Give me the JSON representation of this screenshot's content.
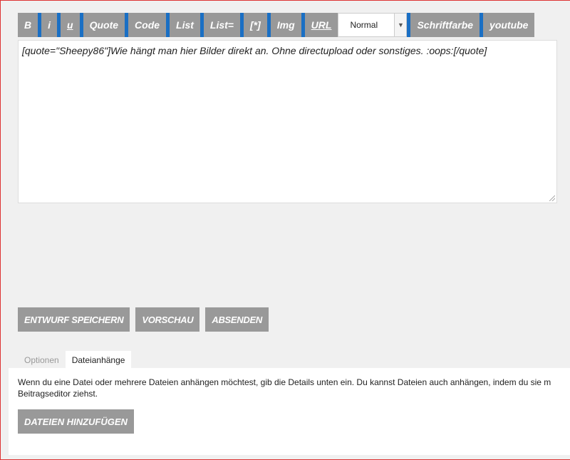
{
  "toolbar": {
    "bold": "B",
    "italic": "i",
    "underline": "u",
    "quote": "Quote",
    "code": "Code",
    "list": "List",
    "list_ordered": "List=",
    "list_item": "[*]",
    "img": "Img",
    "url": "URL",
    "font_size_selected": "Normal",
    "font_color": "Schriftfarbe",
    "youtube": "youtube"
  },
  "editor": {
    "content": "[quote=\"Sheepy86\"]Wie hängt man hier Bilder direkt an. Ohne directupload oder sonstiges.  :oops:[/quote]"
  },
  "actions": {
    "save_draft": "ENTWURF SPEICHERN",
    "preview": "VORSCHAU",
    "submit": "ABSENDEN"
  },
  "tabs": [
    {
      "label": "Optionen",
      "active": false
    },
    {
      "label": "Dateianhänge",
      "active": true
    }
  ],
  "attachments": {
    "info_line1": "Wenn du eine Datei oder mehrere Dateien anhängen möchtest, gib die Details unten ein. Du kannst Dateien auch anhängen, indem du sie m",
    "info_line2": "Beitragseditor ziehst.",
    "add_files": "DATEIEN HINZUFÜGEN"
  },
  "colors": {
    "button_bg": "#999999",
    "accent_blue": "#1a6fc4",
    "border_red": "#dd3333"
  }
}
